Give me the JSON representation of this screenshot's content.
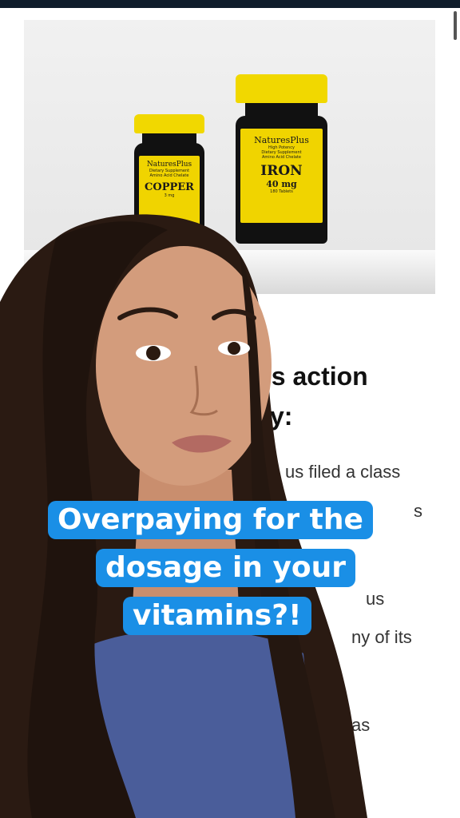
{
  "article": {
    "heading_line1": "ss action",
    "heading_line2": "y:",
    "lines": [
      "us filed a class",
      "s",
      "us",
      "ny of its",
      "as"
    ]
  },
  "products": {
    "copper": {
      "brand": "NaturesPlus",
      "sub1": "Dietary Supplement",
      "sub2": "Amino Acid Chelate",
      "name": "COPPER",
      "dose": "3 mg"
    },
    "iron": {
      "brand": "NaturesPlus",
      "sub0": "High Potency",
      "sub1": "Dietary Supplement",
      "sub2": "Amino Acid Chelate",
      "name": "IRON",
      "dose": "40 mg",
      "count": "180 Tablets"
    }
  },
  "caption": {
    "line1": "Overpaying for the",
    "line2": "dosage in your",
    "line3": "vitamins?!"
  },
  "colors": {
    "caption_bg": "#1a8fe6",
    "label_yellow": "#f0d400",
    "top_bar": "#0f1d2b"
  }
}
